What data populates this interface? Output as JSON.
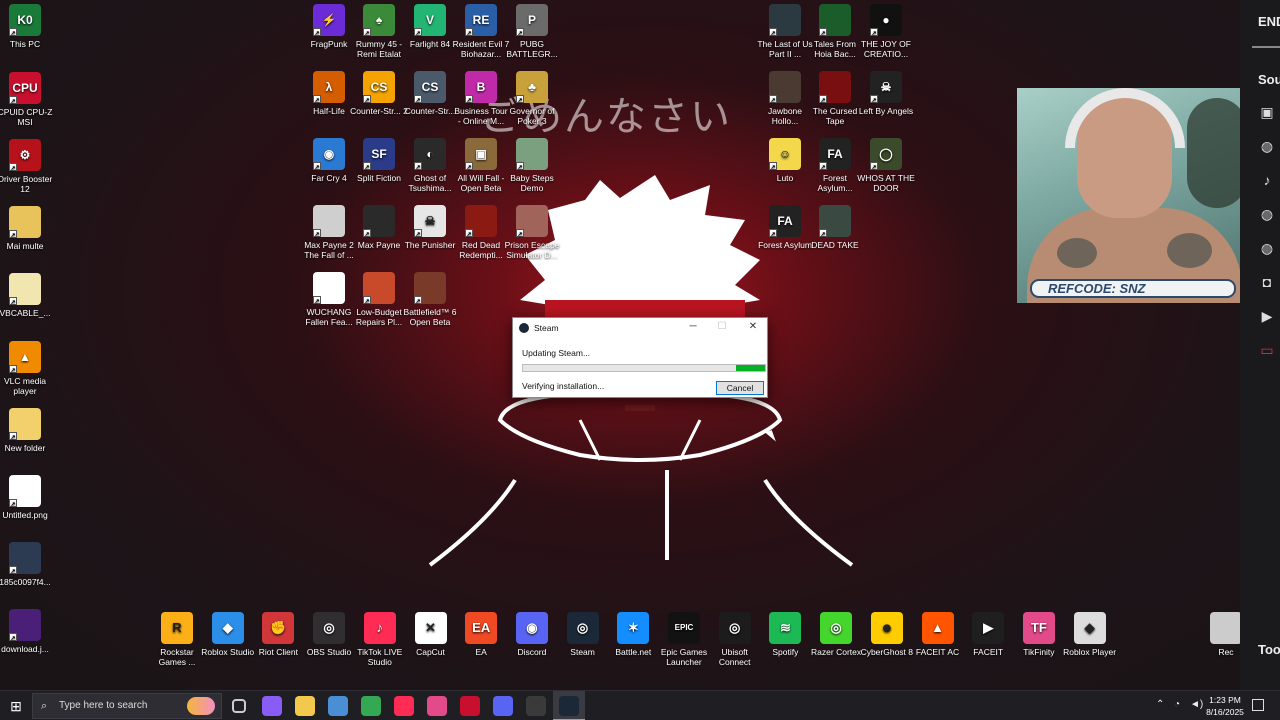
{
  "wallpaper": {
    "japanese_text": "ごめんなさい"
  },
  "desktop_icons": [
    {
      "label": "This PC",
      "color": "#1a7a3a",
      "glyph": "K0"
    },
    {
      "label": "CPUID CPU-Z MSI",
      "color": "#c8102e",
      "glyph": "CPU"
    },
    {
      "label": "Driver Booster 12",
      "color": "#b5121b",
      "glyph": "⚙"
    },
    {
      "label": "Mai multe",
      "color": "#e8c25a",
      "glyph": ""
    },
    {
      "label": "VBCABLE_...",
      "color": "#f2e6b0",
      "glyph": ""
    },
    {
      "label": "VLC media player",
      "color": "#f08a00",
      "glyph": "▲"
    },
    {
      "label": "New folder",
      "color": "#f2d06b",
      "glyph": ""
    },
    {
      "label": "Untitled.png",
      "color": "#ffffff",
      "glyph": ""
    },
    {
      "label": "185c0097f4...",
      "color": "#2c3b52",
      "glyph": ""
    },
    {
      "label": "download.j...",
      "color": "#4a1f78",
      "glyph": ""
    },
    {
      "label": "FragPunk",
      "color": "#6b2bd6",
      "glyph": "⚡"
    },
    {
      "label": "Rummy 45 - Remi Etalat",
      "color": "#3a8a3a",
      "glyph": "♠"
    },
    {
      "label": "Farlight 84",
      "color": "#22b573",
      "glyph": "V"
    },
    {
      "label": "Resident Evil 7 Biohazar...",
      "color": "#2a5fa8",
      "glyph": "RE"
    },
    {
      "label": "PUBG BATTLEGR...",
      "color": "#6b6b6b",
      "glyph": "P"
    },
    {
      "label": "The Last of Us Part II ...",
      "color": "#2b3a40",
      "glyph": ""
    },
    {
      "label": "Tales From Hoia Bac...",
      "color": "#1a5c2a",
      "glyph": ""
    },
    {
      "label": "THE JOY OF CREATIO...",
      "color": "#111111",
      "glyph": "●"
    },
    {
      "label": "Half-Life",
      "color": "#d45d00",
      "glyph": "λ"
    },
    {
      "label": "Counter-Str... 2",
      "color": "#f4a300",
      "glyph": "CS"
    },
    {
      "label": "Counter-Str...",
      "color": "#4a5a6a",
      "glyph": "CS"
    },
    {
      "label": "Business Tour - Online M...",
      "color": "#c02aa8",
      "glyph": "B"
    },
    {
      "label": "Governor of Poker 3",
      "color": "#c8a13a",
      "glyph": "♣"
    },
    {
      "label": "Jawbone Hollo...",
      "color": "#4a3a32",
      "glyph": ""
    },
    {
      "label": "The Cursed Tape",
      "color": "#7a0f12",
      "glyph": ""
    },
    {
      "label": "Left By Angels",
      "color": "#222222",
      "glyph": "☠"
    },
    {
      "label": "Far Cry 4",
      "color": "#2a7ad4",
      "glyph": "◉"
    },
    {
      "label": "Split Fiction",
      "color": "#2a3b8a",
      "glyph": "SF"
    },
    {
      "label": "Ghost of Tsushima...",
      "color": "#2a2a2a",
      "glyph": "◐"
    },
    {
      "label": "All Will Fall - Open Beta",
      "color": "#8a6a3a",
      "glyph": "▣"
    },
    {
      "label": "Baby Steps Demo",
      "color": "#7aa080",
      "glyph": ""
    },
    {
      "label": "Luto",
      "color": "#f2d84a",
      "glyph": "☺"
    },
    {
      "label": "Forest Asylum...",
      "color": "#222222",
      "glyph": "FA"
    },
    {
      "label": "WHOS AT THE DOOR",
      "color": "#3a4a2a",
      "glyph": "◯"
    },
    {
      "label": "Max Payne 2 The Fall of ...",
      "color": "#cfcfcf",
      "glyph": ""
    },
    {
      "label": "Max Payne",
      "color": "#2a2a2a",
      "glyph": ""
    },
    {
      "label": "The Punisher",
      "color": "#e6e6e6",
      "glyph": "☠"
    },
    {
      "label": "Red Dead Redempti...",
      "color": "#8a1a12",
      "glyph": ""
    },
    {
      "label": "Prison Escape Simulator D...",
      "color": "#a0645a",
      "glyph": ""
    },
    {
      "label": "Forest Asylum",
      "color": "#222222",
      "glyph": "FA"
    },
    {
      "label": "DEAD TAKE",
      "color": "#3a4a42",
      "glyph": ""
    },
    {
      "label": "WUCHANG Fallen Fea...",
      "color": "#ffffff",
      "glyph": ""
    },
    {
      "label": "Low-Budget Repairs Pl...",
      "color": "#c84a2a",
      "glyph": ""
    },
    {
      "label": "Battlefield™ 6 Open Beta",
      "color": "#7a3a2a",
      "glyph": ""
    }
  ],
  "dock_icons": [
    {
      "label": "Rockstar Games ...",
      "color": "#fcaf17",
      "glyph": "R"
    },
    {
      "label": "Roblox Studio",
      "color": "#2b8ee8",
      "glyph": "◆"
    },
    {
      "label": "Riot Client",
      "color": "#d13639",
      "glyph": "✊"
    },
    {
      "label": "OBS Studio",
      "color": "#302e31",
      "glyph": "◎"
    },
    {
      "label": "TikTok LIVE Studio",
      "color": "#fe2c55",
      "glyph": "♪"
    },
    {
      "label": "CapCut",
      "color": "#ffffff",
      "glyph": "✕"
    },
    {
      "label": "EA",
      "color": "#f04a24",
      "glyph": "EA"
    },
    {
      "label": "Discord",
      "color": "#5865f2",
      "glyph": "◉"
    },
    {
      "label": "Steam",
      "color": "#1b2838",
      "glyph": "◎"
    },
    {
      "label": "Battle.net",
      "color": "#148eff",
      "glyph": "✶"
    },
    {
      "label": "Epic Games Launcher",
      "color": "#121212",
      "glyph": "EPIC"
    },
    {
      "label": "Ubisoft Connect",
      "color": "#1c1c1c",
      "glyph": "◎"
    },
    {
      "label": "Spotify",
      "color": "#1db954",
      "glyph": "≋"
    },
    {
      "label": "Razer Cortex",
      "color": "#44d62c",
      "glyph": "◎"
    },
    {
      "label": "CyberGhost 8",
      "color": "#ffcc00",
      "glyph": "☻"
    },
    {
      "label": "FACEIT AC",
      "color": "#ff5500",
      "glyph": "▲"
    },
    {
      "label": "FACEIT",
      "color": "#1f1f1f",
      "glyph": "▶"
    },
    {
      "label": "TikFinity",
      "color": "#e24a8a",
      "glyph": "TF"
    },
    {
      "label": "Roblox Player",
      "color": "#dddddd",
      "glyph": "◆"
    },
    {
      "label": "Rec",
      "color": "#cccccc",
      "glyph": ""
    }
  ],
  "steam_dialog": {
    "title": "Steam",
    "status": "Updating Steam...",
    "progress": 0.12,
    "progress_color": "#06b025",
    "verify_text": "Verifying installation...",
    "cancel_label": "Cancel"
  },
  "webcam": {
    "refcode": "REFCODE: SNZ"
  },
  "right_panel": {
    "top_text": "END",
    "sou_text": "Sou",
    "too_text": "Too"
  },
  "taskbar": {
    "search_placeholder": "Type here to search",
    "time": "1:23 PM",
    "date": "8/16/2025",
    "apps": [
      {
        "name": "task-view",
        "color": "#cccccc"
      },
      {
        "name": "copilot",
        "color": "#8a5cf6"
      },
      {
        "name": "file-explorer",
        "color": "#f2c94c"
      },
      {
        "name": "gb-app",
        "color": "#4a8fd4"
      },
      {
        "name": "chrome",
        "color": "#34a853"
      },
      {
        "name": "tiktok",
        "color": "#fe2c55"
      },
      {
        "name": "tikfinity",
        "color": "#e24a8a"
      },
      {
        "name": "red-app",
        "color": "#c8102e"
      },
      {
        "name": "discord",
        "color": "#5865f2"
      },
      {
        "name": "obs",
        "color": "#3a3a3a"
      },
      {
        "name": "steam",
        "color": "#1b2838"
      }
    ]
  }
}
